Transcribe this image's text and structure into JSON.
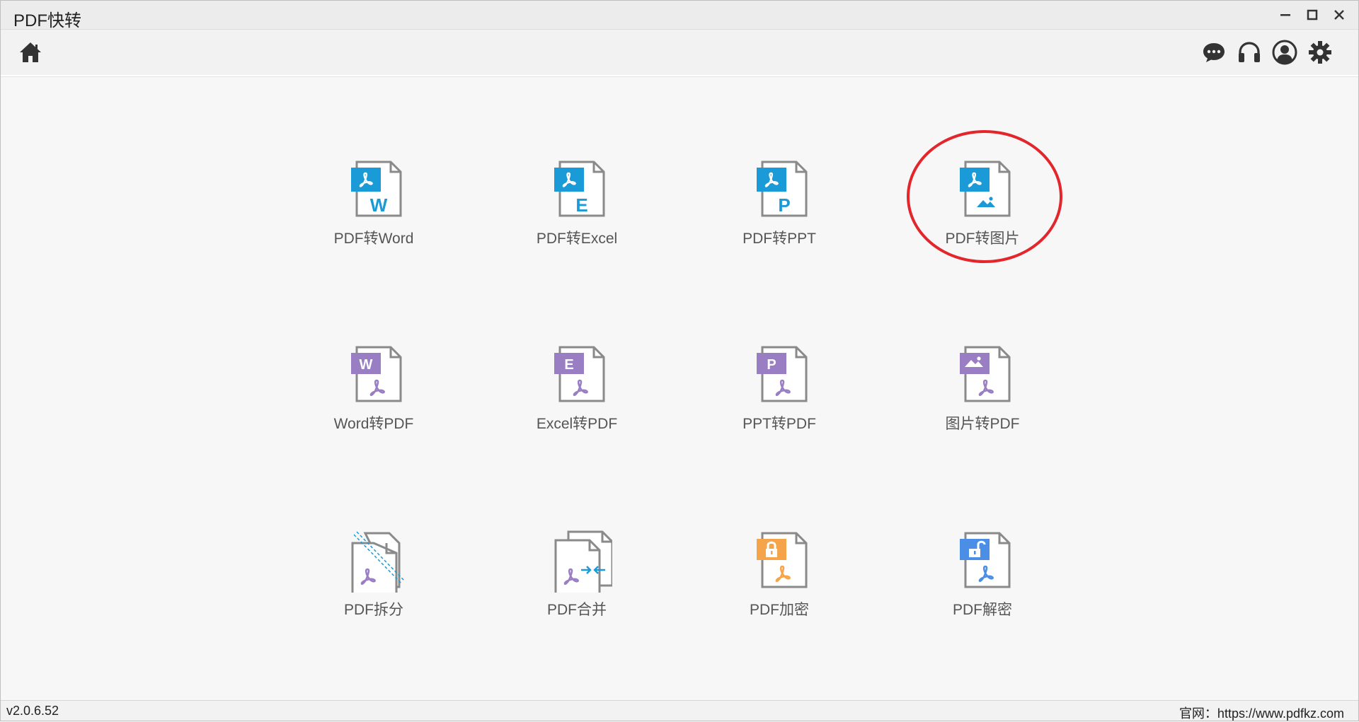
{
  "app": {
    "title": "PDF快转"
  },
  "window_controls": [
    "minimize",
    "maximize",
    "close"
  ],
  "toolbar": {
    "left": [
      "home-icon"
    ],
    "right": [
      "chat-icon",
      "headset-icon",
      "user-icon",
      "settings-icon"
    ]
  },
  "tools": [
    {
      "label": "PDF转Word",
      "badge": "W",
      "type": "pdf-to"
    },
    {
      "label": "PDF转Excel",
      "badge": "E",
      "type": "pdf-to"
    },
    {
      "label": "PDF转PPT",
      "badge": "P",
      "type": "pdf-to"
    },
    {
      "label": "PDF转图片",
      "badge": "image",
      "type": "pdf-to"
    },
    {
      "label": "Word转PDF",
      "badge": "W",
      "type": "to-pdf"
    },
    {
      "label": "Excel转PDF",
      "badge": "E",
      "type": "to-pdf"
    },
    {
      "label": "PPT转PDF",
      "badge": "P",
      "type": "to-pdf"
    },
    {
      "label": "图片转PDF",
      "badge": "image",
      "type": "to-pdf"
    },
    {
      "label": "PDF拆分",
      "badge": "split",
      "type": "split"
    },
    {
      "label": "PDF合并",
      "badge": "merge",
      "type": "merge"
    },
    {
      "label": "PDF加密",
      "badge": "lock",
      "type": "encrypt"
    },
    {
      "label": "PDF解密",
      "badge": "unlock",
      "type": "decrypt"
    }
  ],
  "status": {
    "version": "v2.0.6.52",
    "site": "官网：https://www.pdfkz.com"
  },
  "colors": {
    "pdf_to": "#1a9ad6",
    "to_pdf": "#9a7ec4",
    "merge_arrows": "#1a9ad6",
    "encrypt": "#f5a44a",
    "decrypt": "#4a8ee6",
    "annotation": "#e3262c"
  },
  "annotation": {
    "target": "PDF转图片",
    "shape": "circle"
  }
}
